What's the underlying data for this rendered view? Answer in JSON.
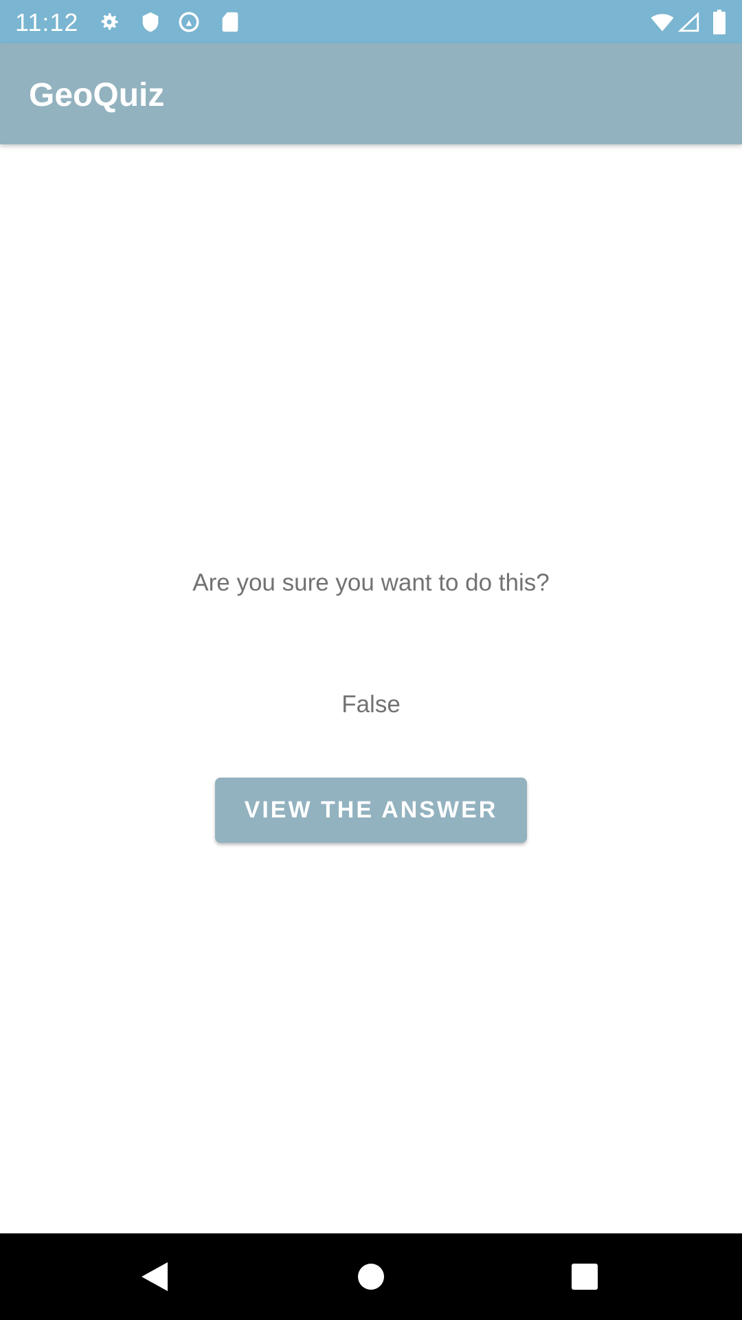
{
  "status_bar": {
    "time": "11:12",
    "icons_left": [
      "settings-icon",
      "shield-icon",
      "at-sync-icon",
      "sd-card-icon"
    ],
    "icons_right": [
      "wifi-icon",
      "signal-icon",
      "battery-icon"
    ]
  },
  "app_bar": {
    "title": "GeoQuiz"
  },
  "main": {
    "question": "Are you sure you want to do this?",
    "answer": "False",
    "button_label": "VIEW THE ANSWER"
  },
  "colors": {
    "status_bar": "#7ab5d1",
    "app_bar": "#93b2bf",
    "button": "#93b2bf",
    "text": "#727272"
  },
  "nav_bar": {
    "icons": [
      "back-icon",
      "home-icon",
      "recents-icon"
    ]
  }
}
